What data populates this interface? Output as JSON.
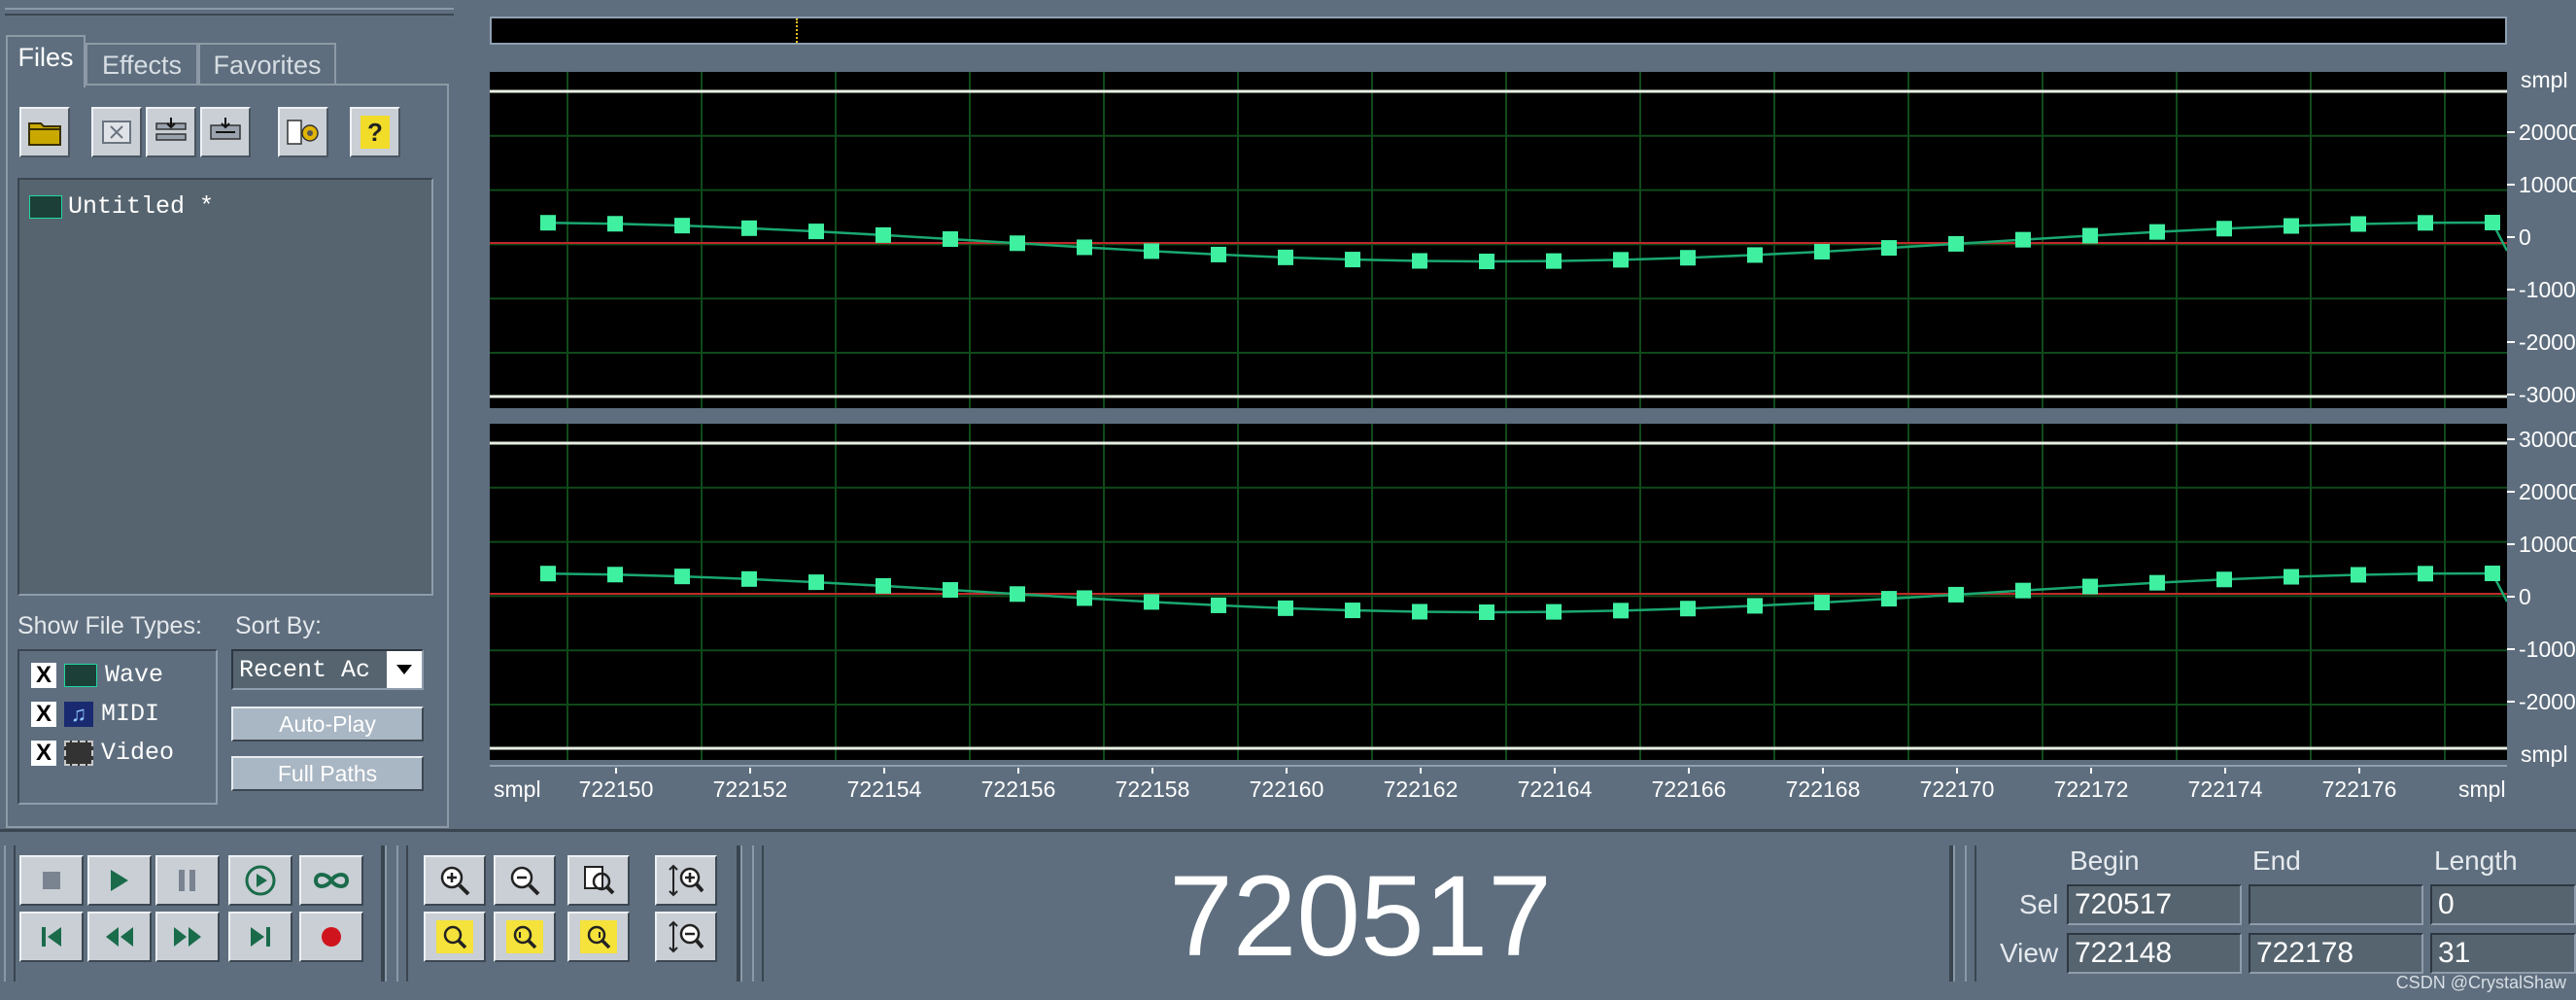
{
  "left_panel": {
    "tabs": [
      {
        "label": "Files",
        "active": true
      },
      {
        "label": "Effects",
        "active": false
      },
      {
        "label": "Favorites",
        "active": false
      }
    ],
    "toolbar_icons": [
      "open-folder-icon",
      "close-file-icon",
      "insert-into-session-icon",
      "insert-into-session-alt-icon",
      "file-info-icon",
      "help-icon"
    ],
    "toolbar_help": "?",
    "files": [
      {
        "name": "Untitled *",
        "icon": "wave-file-icon"
      }
    ],
    "show_file_types_label": "Show File Types:",
    "sort_by_label": "Sort By:",
    "sort_by_value": "Recent Ac",
    "file_types": [
      {
        "label": "Wave",
        "checked": true,
        "icon": "wave-type-icon"
      },
      {
        "label": "MIDI",
        "checked": true,
        "icon": "midi-type-icon"
      },
      {
        "label": "Video",
        "checked": true,
        "icon": "video-type-icon"
      }
    ],
    "check_mark": "X",
    "auto_play_label": "Auto-Play",
    "full_paths_label": "Full Paths"
  },
  "waveform": {
    "unit_label": "smpl",
    "amp_labels_top": [
      "20000",
      "10000",
      "0",
      "-1000",
      "-2000",
      "-3000"
    ],
    "amp_labels_bottom": [
      "30000",
      "20000",
      "10000",
      "0",
      "-1000",
      "-2000"
    ],
    "x_ticks": [
      "722150",
      "722152",
      "722154",
      "722156",
      "722158",
      "722160",
      "722162",
      "722164",
      "722166",
      "722168",
      "722170",
      "722172",
      "722174",
      "722176"
    ],
    "colors": {
      "sample": "#3ef0a0",
      "line": "#1aa870",
      "zero": "#c0282a",
      "grid": "#0f4a1a",
      "clip": "#e8efe4"
    }
  },
  "transport": {
    "row1": [
      "stop-icon",
      "play-icon",
      "pause-icon",
      "play-to-end-icon",
      "loop-icon"
    ],
    "row2": [
      "go-to-start-icon",
      "rewind-icon",
      "fast-forward-icon",
      "go-to-end-icon",
      "record-icon"
    ]
  },
  "zoom": {
    "row1": [
      "zoom-in-icon",
      "zoom-out-icon",
      "zoom-full-icon",
      "zoom-in-vertical-icon"
    ],
    "row2": [
      "zoom-selection-icon",
      "zoom-left-icon",
      "zoom-right-icon",
      "zoom-out-vertical-icon"
    ]
  },
  "time_display": "720517",
  "selection": {
    "headers": {
      "begin": "Begin",
      "end": "End",
      "length": "Length"
    },
    "sel_label": "Sel",
    "view_label": "View",
    "sel": {
      "begin": "720517",
      "end": "",
      "length": "0"
    },
    "view": {
      "begin": "722148",
      "end": "722178",
      "length": "31"
    }
  },
  "watermark": "CSDN @CrystalShaw"
}
